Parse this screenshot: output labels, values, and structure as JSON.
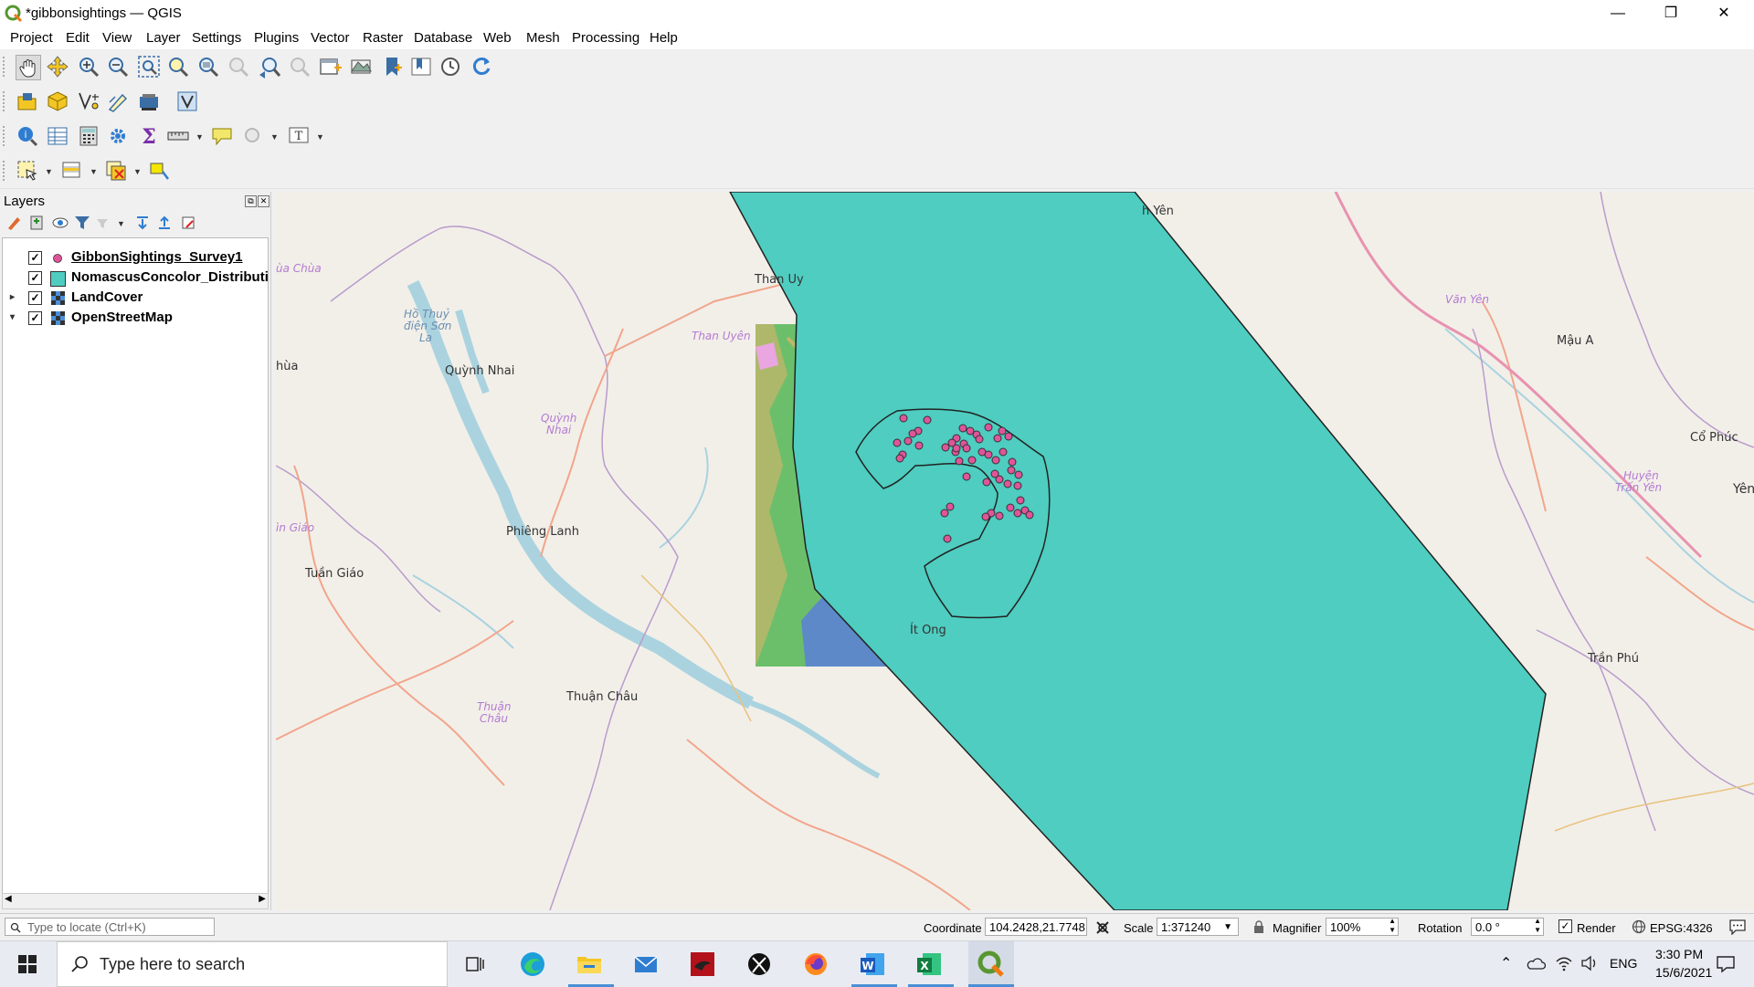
{
  "window": {
    "title": "*gibbonsightings — QGIS",
    "minimize": "—",
    "maximize": "❐",
    "close": "✕"
  },
  "menu": [
    "Project",
    "Edit",
    "View",
    "Layer",
    "Settings",
    "Plugins",
    "Vector",
    "Raster",
    "Database",
    "Web",
    "Mesh",
    "Processing",
    "Help"
  ],
  "layers_panel": {
    "title": "Layers",
    "layers": [
      {
        "name": "GibbonSightings_Survey1",
        "checked": "✓",
        "symbol": "point",
        "underlined": true
      },
      {
        "name": "NomascusConcolor_Distributio",
        "checked": "✓",
        "symbol": "polygon"
      },
      {
        "name": "LandCover",
        "checked": "✓",
        "symbol": "raster",
        "expand": "▸"
      },
      {
        "name": "OpenStreetMap",
        "checked": "✓",
        "symbol": "raster",
        "expand": "▾"
      }
    ],
    "colors": {
      "point": "#e0549a",
      "polygon": "#4ecdc0"
    }
  },
  "map": {
    "labels": {
      "than_uy": "Than Uy",
      "than_uyen": "Than Uyên",
      "ho_thuy_1": "Hồ Thuỷ",
      "ho_thuy_2": "điện Sơn",
      "ho_thuy_3": "La",
      "quynh_nhai": "Quỳnh Nhai",
      "quynh_nhai_i1": "Quỳnh",
      "quynh_nhai_i2": "Nhai",
      "hua": "hùa",
      "ua_chua": "ùa Chùa",
      "phieng_lanh": "Phiêng Lanh",
      "tuan_giao": "Tuần Giáo",
      "in_giao": "ìn Giáo",
      "it_ong": "Ít Ong",
      "thuan_chau": "Thuận Châu",
      "thuan_chau_i1": "Thuận",
      "thuan_chau_i2": "Châu",
      "h_yen": "h Yên",
      "van_yen": "Văn Yên",
      "mau_a": "Mậu A",
      "co_phuc": "Cổ Phúc",
      "huyen_tran_yen_1": "Huyện",
      "huyen_tran_yen_2": "Trấn Yên",
      "yen": "Yên",
      "tran_phu": "Trần Phú"
    }
  },
  "statusbar": {
    "locate_placeholder": "Type to locate (Ctrl+K)",
    "coordinate_label": "Coordinate",
    "coordinate": "104.2428,21.7748",
    "scale_label": "Scale",
    "scale": "1:371240",
    "magnifier_label": "Magnifier",
    "magnifier": "100%",
    "rotation_label": "Rotation",
    "rotation": "0.0 °",
    "render_label": "Render",
    "render_checked": "✓",
    "crs": "EPSG:4326"
  },
  "taskbar": {
    "search_placeholder": "Type here to search",
    "lang": "ENG",
    "time": "3:30 PM",
    "date": "15/6/2021"
  }
}
